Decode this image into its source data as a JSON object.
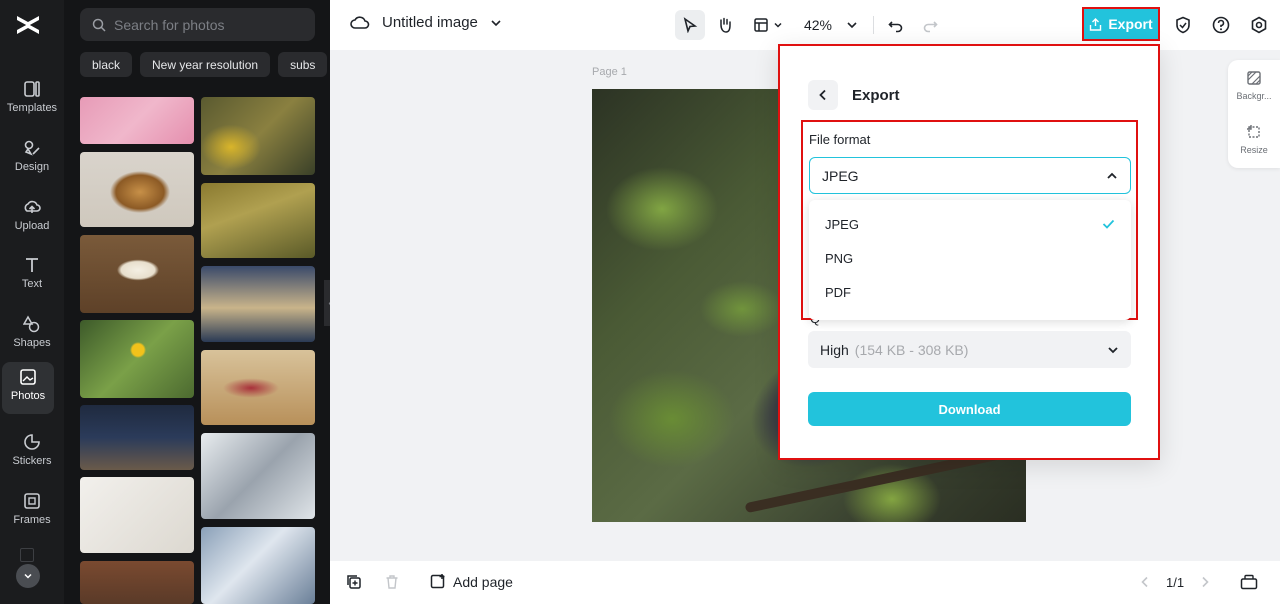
{
  "rail": {
    "items": [
      {
        "label": "Templates",
        "icon": "templates-icon"
      },
      {
        "label": "Design",
        "icon": "design-icon"
      },
      {
        "label": "Upload",
        "icon": "upload-icon"
      },
      {
        "label": "Text",
        "icon": "text-icon"
      },
      {
        "label": "Shapes",
        "icon": "shapes-icon"
      },
      {
        "label": "Photos",
        "icon": "photos-icon",
        "active": true
      },
      {
        "label": "Stickers",
        "icon": "stickers-icon"
      },
      {
        "label": "Frames",
        "icon": "frames-icon"
      }
    ]
  },
  "panel": {
    "search_placeholder": "Search for photos",
    "chips": [
      "black",
      "New year resolution",
      "subs"
    ]
  },
  "topbar": {
    "doc_title": "Untitled image",
    "zoom": "42%",
    "export_label": "Export"
  },
  "canvas": {
    "page_label": "Page 1"
  },
  "side_panel": {
    "background_label": "Backgr...",
    "resize_label": "Resize"
  },
  "bottombar": {
    "add_page_label": "Add page",
    "page_count": "1/1"
  },
  "export_modal": {
    "title": "Export",
    "file_format_label": "File format",
    "selected_format": "JPEG",
    "format_options": [
      "JPEG",
      "PNG",
      "PDF"
    ],
    "quality_value": "High",
    "quality_hint": "(154 KB - 308 KB)",
    "download_label": "Download"
  },
  "colors": {
    "accent": "#22c3dc",
    "highlight": "#e01010",
    "rail_bg": "#1b1c1e"
  }
}
